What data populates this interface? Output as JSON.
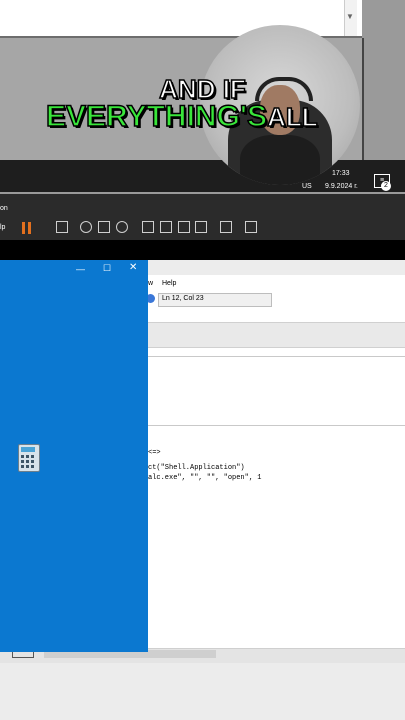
{
  "caption": {
    "line1": "AND IF",
    "highlight": "EVERYTHING'S",
    "rest": "ALL"
  },
  "tray": {
    "time": "17:33",
    "date": "9.9.2024 г.",
    "lang": "US",
    "notif_count": "2"
  },
  "toolbar": {
    "label": "on",
    "lp": "lp"
  },
  "notepad": {
    "menu_view": "w",
    "menu_help": "Help",
    "status": "Ln 12, Col 23",
    "code_arrow": "<=>",
    "code_line1": "ct(\"Shell.Application\")",
    "code_line2": "alc.exe\", \"\", \"\", \"open\", 1"
  },
  "calculator": {
    "minimize": "—",
    "maximize": "☐",
    "close": "✕"
  },
  "colors": {
    "highlight": "#39e63a",
    "calc_blue": "#0b78d0",
    "record_orange": "#e3701e"
  }
}
